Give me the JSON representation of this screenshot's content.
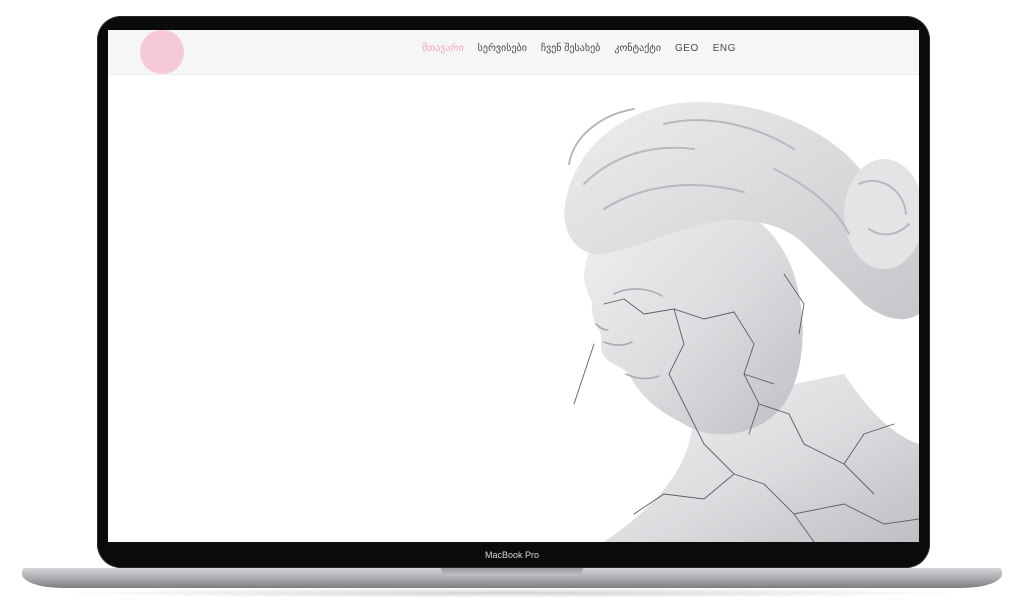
{
  "device": {
    "model_label": "MacBook Pro"
  },
  "site": {
    "logo_text": "",
    "nav": {
      "items": [
        {
          "label": "მთავარი",
          "active": true
        },
        {
          "label": "სერვისები",
          "active": false
        },
        {
          "label": "ჩვენ შესახებ",
          "active": false
        },
        {
          "label": "კონტაქტი",
          "active": false
        }
      ],
      "lang_geo": "GEO",
      "lang_eng": "ENG"
    },
    "hero": {
      "image_subject": "cracked-marble-statue-head"
    }
  },
  "colors": {
    "accent_pink": "#f2a6bf",
    "logo_pink": "#f5c9d8",
    "header_bg": "#f6f6f7",
    "bezel": "#0b0b0c"
  }
}
